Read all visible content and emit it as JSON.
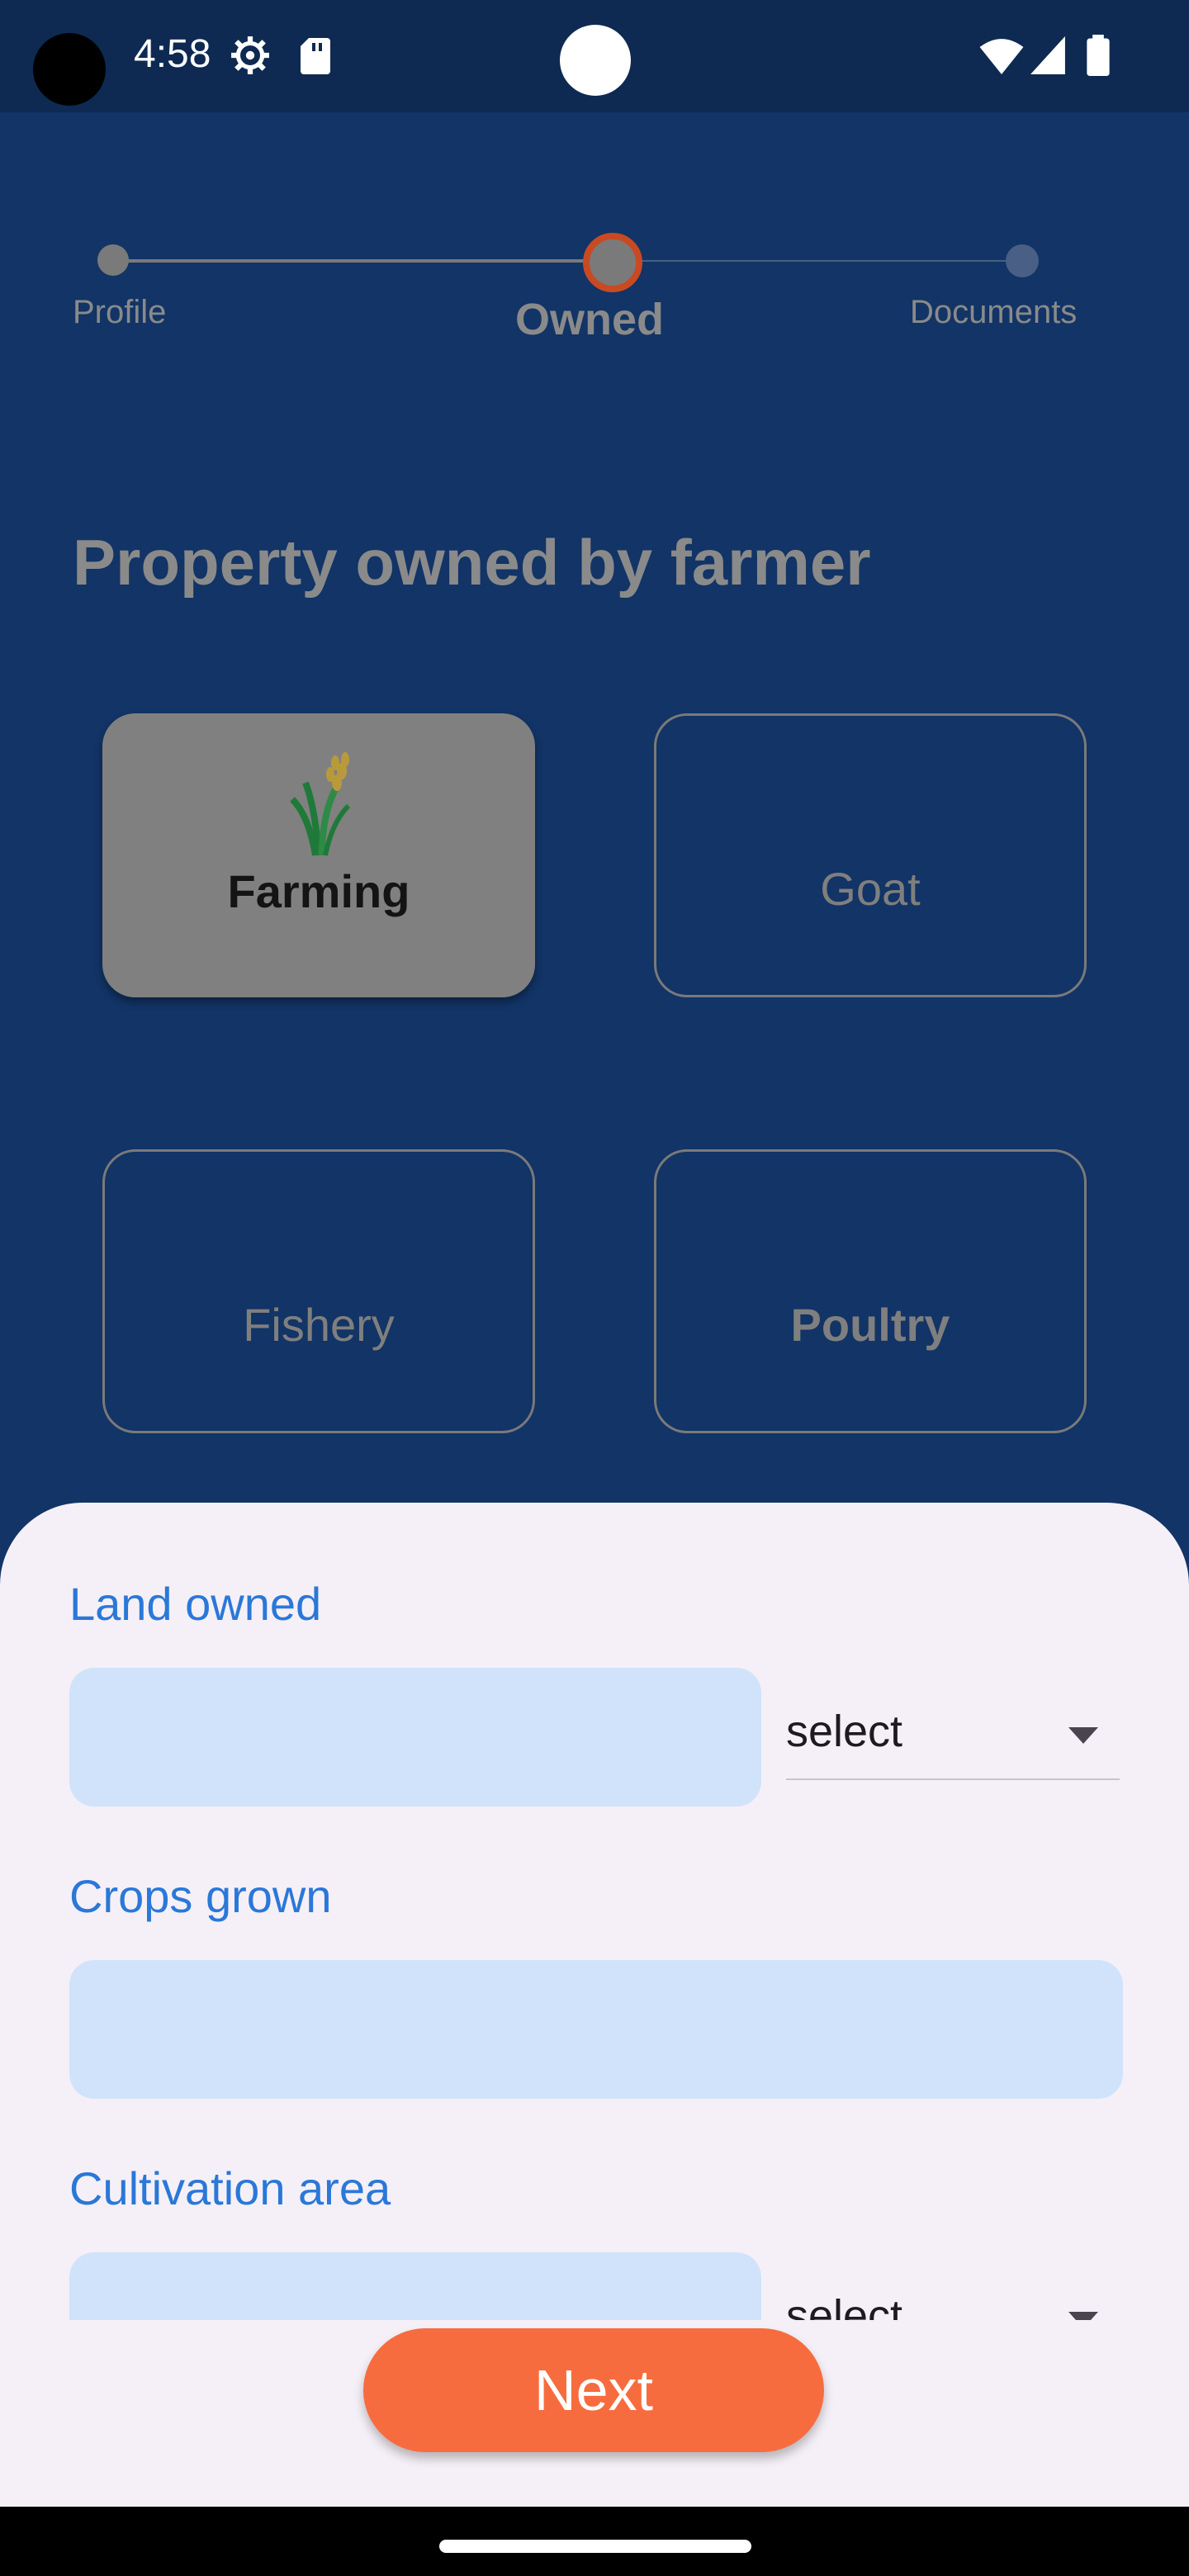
{
  "status_bar": {
    "time": "4:58",
    "icons": [
      "gear-icon",
      "sd-card-icon",
      "wifi-icon",
      "signal-icon",
      "battery-icon"
    ]
  },
  "stepper": {
    "steps": [
      {
        "label": "Profile",
        "state": "done"
      },
      {
        "label": "Owned",
        "state": "current"
      },
      {
        "label": "Documents",
        "state": "todo"
      }
    ]
  },
  "page": {
    "title": "Property owned by farmer"
  },
  "categories": [
    {
      "label": "Farming",
      "selected": true,
      "icon": "wheat-icon"
    },
    {
      "label": "Goat",
      "selected": false
    },
    {
      "label": "Fishery",
      "selected": false
    },
    {
      "label": "Poultry",
      "selected": false
    }
  ],
  "form": {
    "land_owned": {
      "label": "Land owned",
      "value": "",
      "unit_select": "select"
    },
    "crops_grown": {
      "label": "Crops grown",
      "value": ""
    },
    "cultivation_area": {
      "label": "Cultivation area",
      "value": "",
      "unit_select": "select"
    }
  },
  "actions": {
    "next_label": "Next"
  },
  "colors": {
    "background": "#123466",
    "accent": "#f76c3e",
    "selected_ring": "#c94a22",
    "field_label": "#2a78d8",
    "input_fill": "#d1e3fb"
  }
}
